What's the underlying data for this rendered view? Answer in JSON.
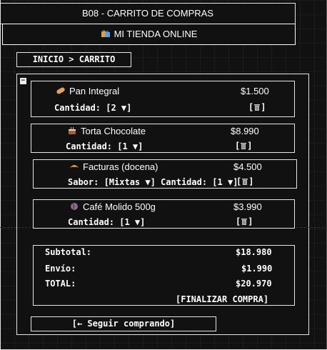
{
  "window": {
    "title": "B08 - CARRITO DE COMPRAS"
  },
  "header": {
    "store_icon": "shopping-bags-icon",
    "store_name": "MI TIENDA ONLINE"
  },
  "breadcrumb": {
    "text": "INICIO > CARRITO"
  },
  "cart": {
    "collapse_label": "−",
    "items": [
      {
        "icon": "bread-icon",
        "name": "Pan Integral",
        "price": "$1.500",
        "options": "Cantidad: [2 ▼]",
        "remove": "[🗑]"
      },
      {
        "icon": "cake-icon",
        "name": "Torta Chocolate",
        "price": "$8.990",
        "options": "Cantidad: [1 ▼]",
        "remove": "[🗑]"
      },
      {
        "icon": "croissant-icon",
        "name": "Facturas (docena)",
        "price": "$4.500",
        "options": "Sabor: [Mixtas ▼] Cantidad: [1 ▼]",
        "remove": "[🗑]"
      },
      {
        "icon": "coffee-beans-icon",
        "name": "Café Molido 500g",
        "price": "$3.990",
        "options": "Cantidad: [1 ▼]",
        "remove": "[🗑]"
      }
    ],
    "summary": {
      "subtotal_label": "Subtotal:",
      "subtotal_value": "$18.980",
      "shipping_label": "Envío:",
      "shipping_value": "$1.990",
      "total_label": "TOTAL:",
      "total_value": "$20.970",
      "checkout_label": "[FINALIZAR COMPRA]"
    },
    "continue_label": "[← Seguir comprando]"
  },
  "colors": {
    "background": "#111111",
    "border": "#e6e6e6",
    "text": "#ffffff"
  }
}
